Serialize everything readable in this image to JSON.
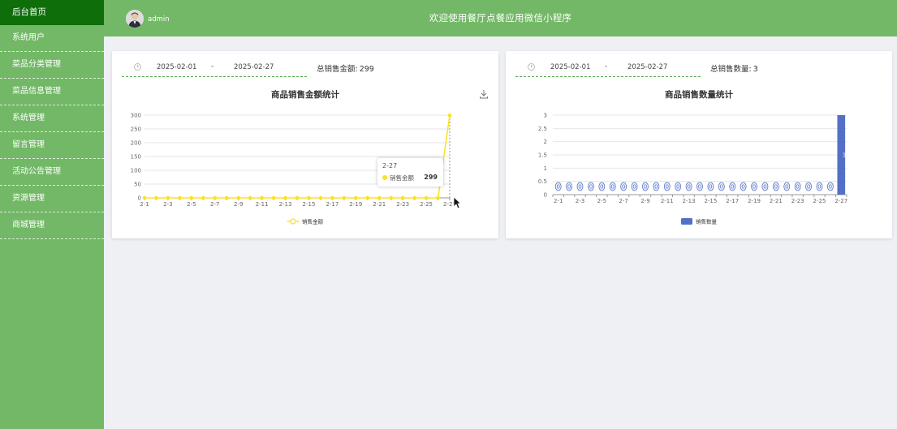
{
  "sidebar": {
    "items": [
      {
        "label": "后台首页"
      },
      {
        "label": "系统用户"
      },
      {
        "label": "菜品分类管理"
      },
      {
        "label": "菜品信息管理"
      },
      {
        "label": "系统管理"
      },
      {
        "label": "留言管理"
      },
      {
        "label": "活动公告管理"
      },
      {
        "label": "资源管理"
      },
      {
        "label": "商城管理"
      }
    ]
  },
  "header": {
    "username": "admin",
    "title": "欢迎使用餐厅点餐应用微信小程序"
  },
  "colors": {
    "primary": "#72b866",
    "sidebar_active": "#0d6e0a",
    "line_series": "#fde21f",
    "bar_series": "#5470c6"
  },
  "icons": [
    "clock-icon",
    "download-icon",
    "avatar",
    "cursor-icon"
  ],
  "amount_card": {
    "date_start": "2025-02-01",
    "date_sep": "-",
    "date_end": "2025-02-27",
    "total_label": "总销售金额:",
    "total_value": "299",
    "chart_title": "商品销售金额统计",
    "tooltip": {
      "title": "2-27",
      "series": "销售金额",
      "value": "299"
    }
  },
  "quantity_card": {
    "date_start": "2025-02-01",
    "date_sep": "-",
    "date_end": "2025-02-27",
    "total_label": "总销售数量:",
    "total_value": "3",
    "chart_title": "商品销售数量统计"
  },
  "chart_data": [
    {
      "type": "line",
      "title": "商品销售金额统计",
      "x": [
        "2-1",
        "2-2",
        "2-3",
        "2-4",
        "2-5",
        "2-6",
        "2-7",
        "2-8",
        "2-9",
        "2-10",
        "2-11",
        "2-12",
        "2-13",
        "2-14",
        "2-15",
        "2-16",
        "2-17",
        "2-18",
        "2-19",
        "2-20",
        "2-21",
        "2-22",
        "2-23",
        "2-24",
        "2-25",
        "2-26",
        "2-27"
      ],
      "x_tick_labels": [
        "2-1",
        "2-3",
        "2-5",
        "2-7",
        "2-9",
        "2-11",
        "2-13",
        "2-15",
        "2-17",
        "2-19",
        "2-21",
        "2-23",
        "2-25",
        "2-27"
      ],
      "series": [
        {
          "name": "销售金额",
          "values": [
            0,
            0,
            0,
            0,
            0,
            0,
            0,
            0,
            0,
            0,
            0,
            0,
            0,
            0,
            0,
            0,
            0,
            0,
            0,
            0,
            0,
            0,
            0,
            0,
            0,
            0,
            299
          ]
        }
      ],
      "ylim": [
        0,
        300
      ],
      "y_ticks": [
        0,
        50,
        100,
        150,
        200,
        250,
        300
      ],
      "grid": true,
      "legend": "bottom-center"
    },
    {
      "type": "bar",
      "title": "商品销售数量统计",
      "categories": [
        "2-1",
        "2-2",
        "2-3",
        "2-4",
        "2-5",
        "2-6",
        "2-7",
        "2-8",
        "2-9",
        "2-10",
        "2-11",
        "2-12",
        "2-13",
        "2-14",
        "2-15",
        "2-16",
        "2-17",
        "2-18",
        "2-19",
        "2-20",
        "2-21",
        "2-22",
        "2-23",
        "2-24",
        "2-25",
        "2-26",
        "2-27"
      ],
      "x_tick_labels": [
        "2-1",
        "2-3",
        "2-5",
        "2-7",
        "2-9",
        "2-11",
        "2-13",
        "2-15",
        "2-17",
        "2-19",
        "2-21",
        "2-23",
        "2-25",
        "2-27"
      ],
      "series": [
        {
          "name": "销售数量",
          "values": [
            0,
            0,
            0,
            0,
            0,
            0,
            0,
            0,
            0,
            0,
            0,
            0,
            0,
            0,
            0,
            0,
            0,
            0,
            0,
            0,
            0,
            0,
            0,
            0,
            0,
            0,
            3
          ]
        }
      ],
      "ylim": [
        0,
        3
      ],
      "y_ticks": [
        "0",
        "0.5",
        "1",
        "1.5",
        "2",
        "2.5",
        "3"
      ],
      "grid": true,
      "legend": "bottom-center"
    }
  ]
}
